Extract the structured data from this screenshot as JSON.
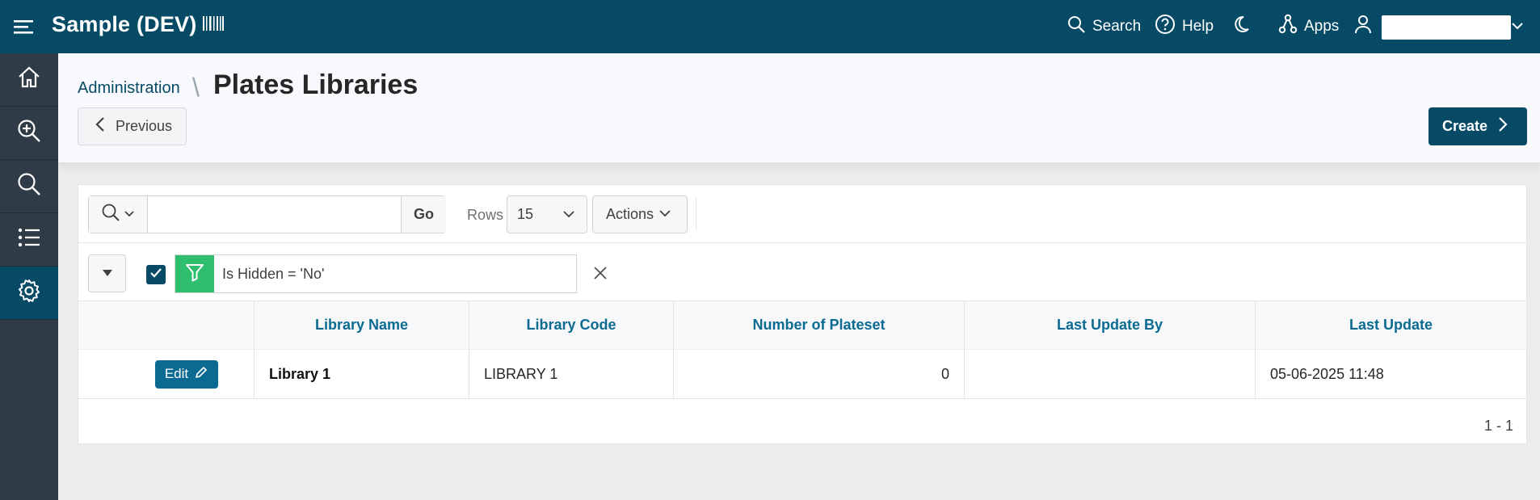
{
  "header": {
    "app_title": "Sample (DEV)",
    "search_label": "Search",
    "help_label": "Help",
    "apps_label": "Apps",
    "user_name": ""
  },
  "sidebar": {
    "items": [
      {
        "name": "home-icon"
      },
      {
        "name": "zoom-in-icon"
      },
      {
        "name": "search-icon"
      },
      {
        "name": "list-icon"
      },
      {
        "name": "gear-icon",
        "active": true
      }
    ]
  },
  "page": {
    "breadcrumb": "Administration",
    "title": "Plates Libraries",
    "previous_label": "Previous",
    "create_label": "Create"
  },
  "toolbar": {
    "search_value": "",
    "go_label": "Go",
    "rows_label": "Rows",
    "rows_value": "15",
    "actions_label": "Actions"
  },
  "filter": {
    "text": "Is Hidden = 'No'"
  },
  "grid": {
    "columns": [
      "",
      "Library Name",
      "Library Code",
      "Number of Plateset",
      "Last Update By",
      "Last Update"
    ],
    "rows": [
      {
        "edit_label": "Edit",
        "library_name": "Library 1",
        "library_code": "LIBRARY 1",
        "number_of_plateset": "0",
        "last_update_by": "",
        "last_update": "05-06-2025 11:48"
      }
    ],
    "pagination": "1 - 1"
  },
  "colors": {
    "header_bg": "#064a66",
    "sidebar_bg": "#2f3b46",
    "link": "#0b6a92",
    "filter_green": "#2ebf6e"
  }
}
